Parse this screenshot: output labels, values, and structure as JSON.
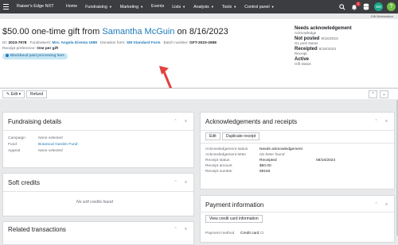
{
  "nav": {
    "brand": "Raiser's Edge NXT",
    "items": [
      {
        "label": "Home",
        "caret": false
      },
      {
        "label": "Fundraising",
        "caret": true
      },
      {
        "label": "Marketing",
        "caret": true
      },
      {
        "label": "Events",
        "caret": false
      },
      {
        "label": "Lists",
        "caret": true
      },
      {
        "label": "Analysis",
        "caret": true
      },
      {
        "label": "Tools",
        "caret": true
      },
      {
        "label": "Control panel",
        "caret": true
      }
    ],
    "notification_count": "1",
    "user_initials": "SM",
    "help_label": "?",
    "workspace": "Gift Workstation"
  },
  "gift": {
    "title_prefix": "$50.00 one-time gift from",
    "constituent": "Samantha McGuin",
    "title_on": "on 8/16/2023",
    "id_label": "ID:",
    "id_value": "2023-7978",
    "fundraisers_label": "Fundraisers:",
    "fundraisers_value": "Mrs. Angela Diresta 1989",
    "donation_form_label": "Donation form:",
    "donation_form_value": "SM Standard Form",
    "batch_label": "Batch number:",
    "batch_value": "GFT-2023-2658",
    "receipt_pref_label": "Receipt preference:",
    "receipt_pref_value": "One per gift",
    "chip": "Blackbaud paid processing fees"
  },
  "status": {
    "ack_value": "Needs acknowledgement",
    "ack_label": "Acknowledge",
    "gl_value": "Not posted",
    "gl_date": "8/16/2023",
    "gl_label": "GL post status",
    "receipt_value": "Receipted",
    "receipt_date": "8/16/2023",
    "receipt_label": "Receipt",
    "gift_value": "Active",
    "gift_label": "Gift status"
  },
  "toolbar": {
    "edit": "Edit",
    "refund": "Refund",
    "prev": "⌃",
    "next": "⌄"
  },
  "fundraising": {
    "title": "Fundraising details",
    "rows": [
      {
        "k": "Campaign",
        "v": "None selected",
        "style": "ital"
      },
      {
        "k": "Fund",
        "v": "Botanical Garden Fund",
        "style": "link"
      },
      {
        "k": "Appeal",
        "v": "None selected",
        "style": "ital"
      }
    ]
  },
  "soft_credits": {
    "title": "Soft credits",
    "empty": "No soft credits found"
  },
  "related": {
    "title": "Related transactions"
  },
  "ack": {
    "title": "Acknowledgements and receipts",
    "edit": "Edit",
    "duplicate": "Duplicate receipt",
    "rows": [
      {
        "k": "Acknowledgement status",
        "v": "Needs acknowledgement",
        "style": ""
      },
      {
        "k": "Acknowledgement letter",
        "v": "No letter found",
        "style": "ital"
      },
      {
        "k": "Receipt status",
        "v": "Receipted",
        "style": "",
        "date": "08/16/2023"
      },
      {
        "k": "Receipt amount",
        "v": "$50.00",
        "style": ""
      },
      {
        "k": "Receipt number",
        "v": "88193",
        "style": ""
      }
    ]
  },
  "payment": {
    "title": "Payment information",
    "view_cc": "View credit card information",
    "method_label": "Payment method",
    "method_value": "Credit card"
  }
}
